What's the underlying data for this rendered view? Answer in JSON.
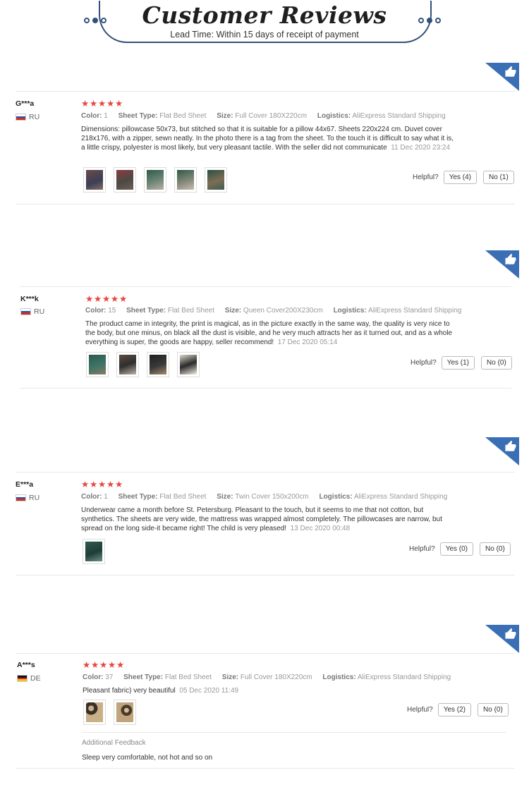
{
  "header": {
    "title": "Customer Reviews",
    "subtitle": "Lead Time: Within 15 days of receipt of payment"
  },
  "labels": {
    "color": "Color:",
    "sheet_type": "Sheet Type:",
    "size": "Size:",
    "logistics": "Logistics:",
    "helpful": "Helpful?"
  },
  "colors": {
    "star": "#e5463f",
    "corner": "#3a6fb5",
    "header_border": "#33507a"
  },
  "reviews": [
    {
      "user": "G***a",
      "country": "RU",
      "stars": "★★★★★",
      "color": "1",
      "sheet_type": "Flat Bed Sheet",
      "size": "Full Cover 180X220cm",
      "logistics": "AliExpress Standard Shipping",
      "text": "Dimensions: pillowcase 50x73, but stitched so that it is suitable for a pillow 44x67. Sheets 220x224 cm. Duvet cover 218x176, with a zipper, sewn neatly. In the photo there is a tag from the sheet. To the touch it is difficult to say what it is, a little crispy, polyester is most likely, but very pleasant tactile. With the seller did not communicate",
      "date": "11 Dec 2020 23:24",
      "yes": "Yes (4)",
      "no": "No (1)"
    },
    {
      "user": "K***k",
      "country": "RU",
      "stars": "★★★★★",
      "color": "15",
      "sheet_type": "Flat Bed Sheet",
      "size": "Queen Cover200X230cm",
      "logistics": "AliExpress Standard Shipping",
      "text": "The product came in integrity, the print is magical, as in the picture exactly in the same way, the quality is very nice to the body, but one minus, on black all the dust is visible, and he very much attracts her as it turned out, and as a whole everything is super, the goods are happy, seller recommend!",
      "date": "17 Dec 2020 05:14",
      "yes": "Yes (1)",
      "no": "No (0)"
    },
    {
      "user": "E***a",
      "country": "RU",
      "stars": "★★★★★",
      "color": "1",
      "sheet_type": "Flat Bed Sheet",
      "size": "Twin Cover 150x200cm",
      "logistics": "AliExpress Standard Shipping",
      "text": "Underwear came a month before St. Petersburg. Pleasant to the touch, but it seems to me that not cotton, but synthetics. The sheets are very wide, the mattress was wrapped almost completely. The pillowcases are narrow, but spread on the long side-it became right! The child is very pleased!",
      "date": "13 Dec 2020 00:48",
      "yes": "Yes (0)",
      "no": "No (0)"
    },
    {
      "user": "A***s",
      "country": "DE",
      "stars": "★★★★★",
      "color": "37",
      "sheet_type": "Flat Bed Sheet",
      "size": "Full Cover 180X220cm",
      "logistics": "AliExpress Standard Shipping",
      "text": "Pleasant fabric) very beautiful",
      "date": "05 Dec 2020 11:49",
      "yes": "Yes (2)",
      "no": "No (0)",
      "additional_label": "Additional Feedback",
      "additional_text": "Sleep very comfortable, not hot and so on"
    }
  ]
}
